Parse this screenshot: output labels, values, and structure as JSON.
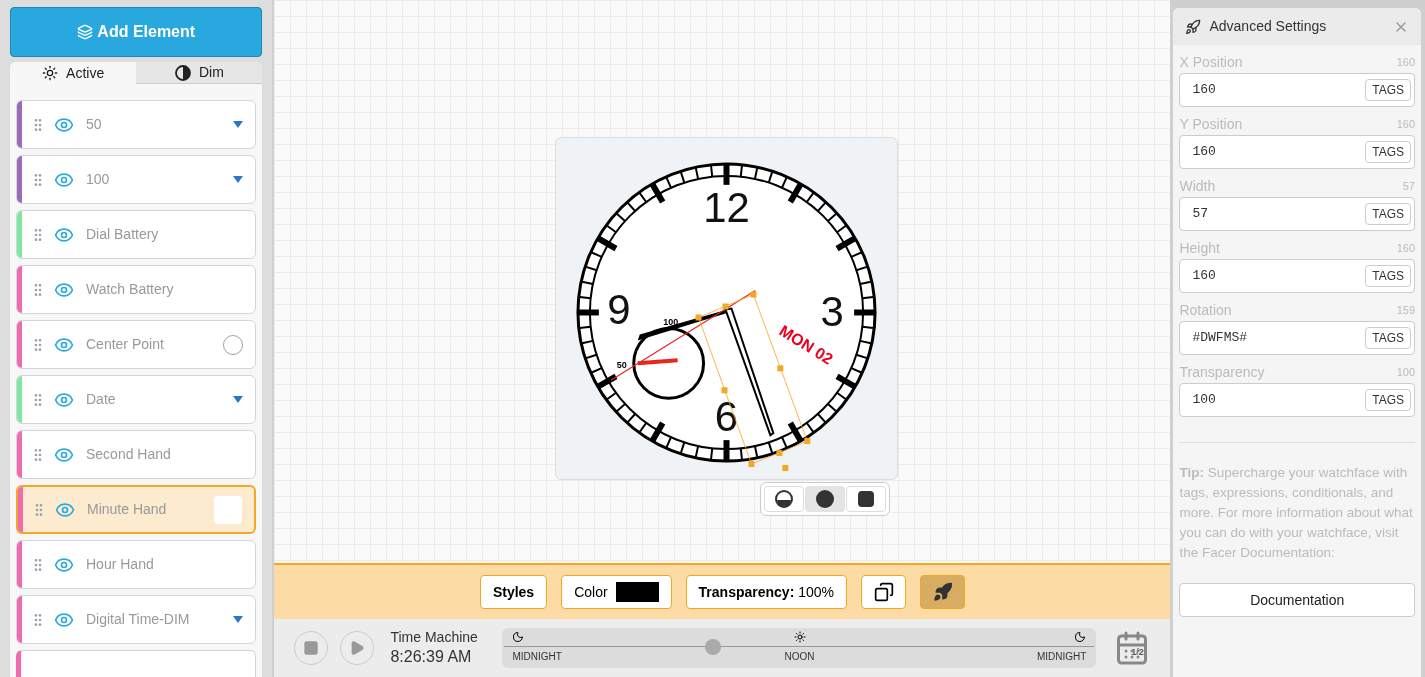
{
  "sidebar": {
    "add_button": "Add Element",
    "tabs": [
      {
        "label": "Active",
        "kind": "sun",
        "selected": true
      },
      {
        "label": "Dim",
        "kind": "contrast",
        "selected": false
      }
    ],
    "layers": [
      {
        "name": "50",
        "color": "#9b6bb5",
        "kind": "dropdown",
        "selected": false
      },
      {
        "name": "100",
        "color": "#9b6bb5",
        "kind": "dropdown",
        "selected": false
      },
      {
        "name": "Dial Battery",
        "color": "#7ee8a0",
        "kind": "plain",
        "selected": false
      },
      {
        "name": "Watch Battery",
        "color": "#f06ab0",
        "kind": "plain",
        "selected": false
      },
      {
        "name": "Center Point",
        "color": "#f06ab0",
        "kind": "circle",
        "selected": false
      },
      {
        "name": "Date",
        "color": "#7ee8a0",
        "kind": "dropdown",
        "selected": false
      },
      {
        "name": "Second Hand",
        "color": "#f06ab0",
        "kind": "plain",
        "selected": false
      },
      {
        "name": "Minute Hand",
        "color": "#f06ab0",
        "kind": "swatch",
        "selected": true
      },
      {
        "name": "Hour Hand",
        "color": "#f06ab0",
        "kind": "plain",
        "selected": false
      },
      {
        "name": "Digital Time-DIM",
        "color": "#f06ab0",
        "kind": "dropdown",
        "selected": false
      }
    ]
  },
  "watch": {
    "numerals": [
      "12",
      "3",
      "6",
      "9"
    ],
    "subdial_labels": [
      "100",
      "50"
    ],
    "date": "MON 02",
    "display_modes": [
      {
        "kind": "half",
        "selected": false
      },
      {
        "kind": "round",
        "selected": true
      },
      {
        "kind": "square",
        "selected": false
      }
    ]
  },
  "toolbar": {
    "styles": "Styles",
    "color_label": "Color",
    "color": "#000000",
    "transparency": "**Transparency:** 100%",
    "advanced_on": true
  },
  "time_machine": {
    "title": "Time Machine",
    "time": "8:26:39 AM",
    "level": 0.35,
    "labels": [
      "MIDNIGHT",
      "NOON",
      "MIDNIGHT"
    ],
    "calendar": "1/2"
  },
  "advanced": {
    "title": "Advanced Settings",
    "fields": [
      {
        "label": "X Position",
        "current": "160",
        "value": "160",
        "tags": "TAGS"
      },
      {
        "label": "Y Position",
        "current": "160",
        "value": "160",
        "tags": "TAGS"
      },
      {
        "label": "Width",
        "current": "57",
        "value": "57",
        "tags": "TAGS"
      },
      {
        "label": "Height",
        "current": "160",
        "value": "160",
        "tags": "TAGS"
      },
      {
        "label": "Rotation",
        "current": "159",
        "value": "#DWFMS#",
        "tags": "TAGS"
      },
      {
        "label": "Transparency",
        "current": "100",
        "value": "100",
        "tags": "TAGS"
      }
    ],
    "tip": "**Tip:** Supercharge your watchface with tags, expressions, conditionals, and more. For more information about what you can do with your watchface, visit the Facer Documentation:",
    "doc_button": "Documentation"
  }
}
